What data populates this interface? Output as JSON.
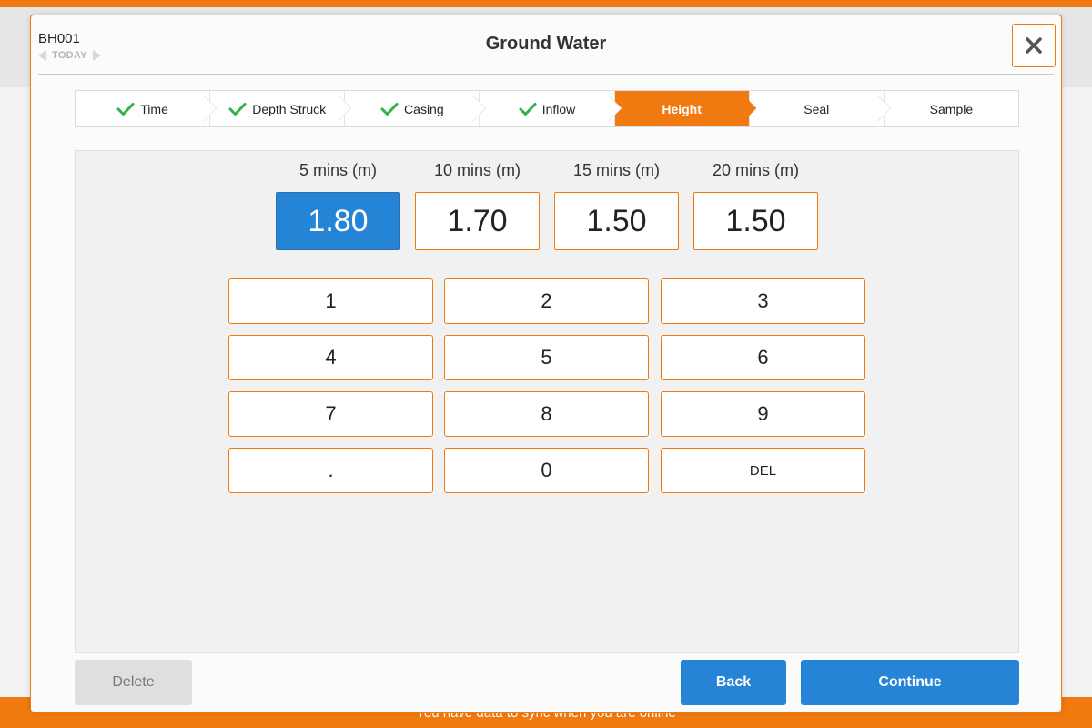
{
  "background": {
    "footer_text": "You have data to sync when you are online"
  },
  "modal": {
    "borehole_id": "BH001",
    "date_label": "TODAY",
    "title": "Ground Water",
    "close_icon": "close-icon"
  },
  "steps": [
    {
      "label": "Time",
      "completed": true,
      "active": false
    },
    {
      "label": "Depth Struck",
      "completed": true,
      "active": false
    },
    {
      "label": "Casing",
      "completed": true,
      "active": false
    },
    {
      "label": "Inflow",
      "completed": true,
      "active": false
    },
    {
      "label": "Height",
      "completed": false,
      "active": true
    },
    {
      "label": "Seal",
      "completed": false,
      "active": false
    },
    {
      "label": "Sample",
      "completed": false,
      "active": false
    }
  ],
  "readings": [
    {
      "label": "5 mins (m)",
      "value": "1.80",
      "selected": true
    },
    {
      "label": "10 mins (m)",
      "value": "1.70",
      "selected": false
    },
    {
      "label": "15 mins (m)",
      "value": "1.50",
      "selected": false
    },
    {
      "label": "20 mins (m)",
      "value": "1.50",
      "selected": false
    }
  ],
  "keypad": [
    "1",
    "2",
    "3",
    "4",
    "5",
    "6",
    "7",
    "8",
    "9",
    ".",
    "0",
    "DEL"
  ],
  "buttons": {
    "delete": "Delete",
    "back": "Back",
    "continue": "Continue"
  },
  "colors": {
    "accent": "#f07a10",
    "primary": "#2684d6",
    "check": "#2db34a"
  }
}
